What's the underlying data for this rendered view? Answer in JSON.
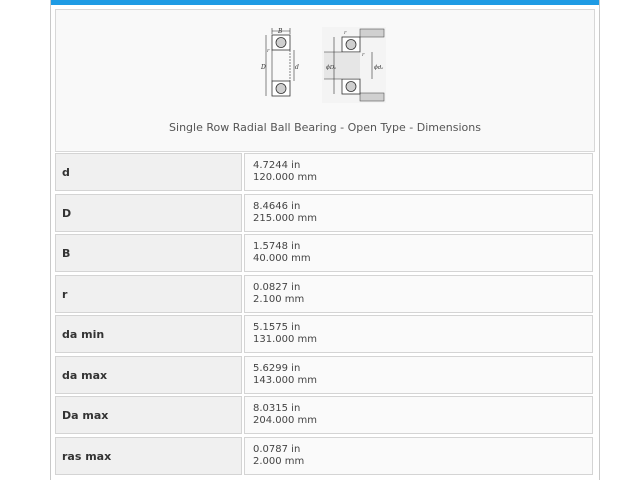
{
  "figure": {
    "caption": "Single Row Radial Ball Bearing - Open Type - Dimensions",
    "diagram_labels": {
      "B": "B",
      "r_left": "r",
      "D": "D",
      "d": "d",
      "r_right": "r",
      "r_small": "r",
      "Da": "ϕDₐ",
      "da": "ϕdₐ"
    }
  },
  "dimensions": [
    {
      "label": "d",
      "inch": "4.7244 in",
      "mm": "120.000 mm"
    },
    {
      "label": "D",
      "inch": "8.4646 in",
      "mm": "215.000 mm"
    },
    {
      "label": "B",
      "inch": "1.5748 in",
      "mm": "40.000 mm"
    },
    {
      "label": "r",
      "inch": "0.0827 in",
      "mm": "2.100 mm"
    },
    {
      "label": "da min",
      "inch": "5.1575 in",
      "mm": "131.000 mm"
    },
    {
      "label": "da max",
      "inch": "5.6299 in",
      "mm": "143.000 mm"
    },
    {
      "label": "Da max",
      "inch": "8.0315 in",
      "mm": "204.000 mm"
    },
    {
      "label": "ras max",
      "inch": "0.0787 in",
      "mm": "2.000 mm"
    }
  ],
  "colors": {
    "accent": "#1e9be4"
  }
}
